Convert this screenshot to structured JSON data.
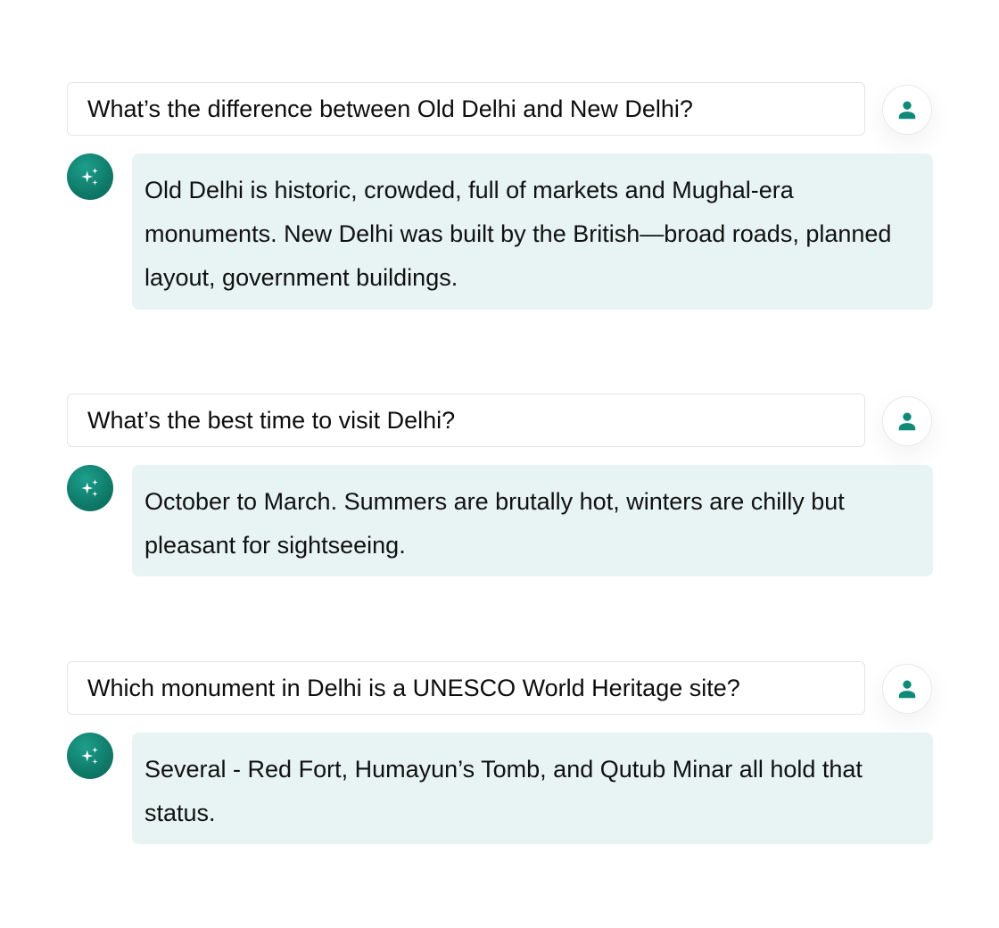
{
  "conversation": [
    {
      "question": "What’s the difference between Old Delhi and New Delhi?",
      "answer": "Old Delhi is historic, crowded, full of markets and Mughal-era monuments. New Delhi was built by the British—broad roads, planned layout, government buildings."
    },
    {
      "question": "What’s the best time to visit Delhi?",
      "answer": "October to March. Summers are brutally hot, winters are chilly but pleasant for sightseeing."
    },
    {
      "question": "Which monument in Delhi is a UNESCO World Heritage site?",
      "answer": "Several - Red Fort, Humayun’s Tomb, and Qutub Minar all hold that status."
    }
  ],
  "icons": {
    "user": "person-icon",
    "assistant": "sparkle-icon"
  },
  "colors": {
    "accent": "#0f8a78",
    "answer_background": "#e7f4f3",
    "border": "#e3e6e6"
  }
}
